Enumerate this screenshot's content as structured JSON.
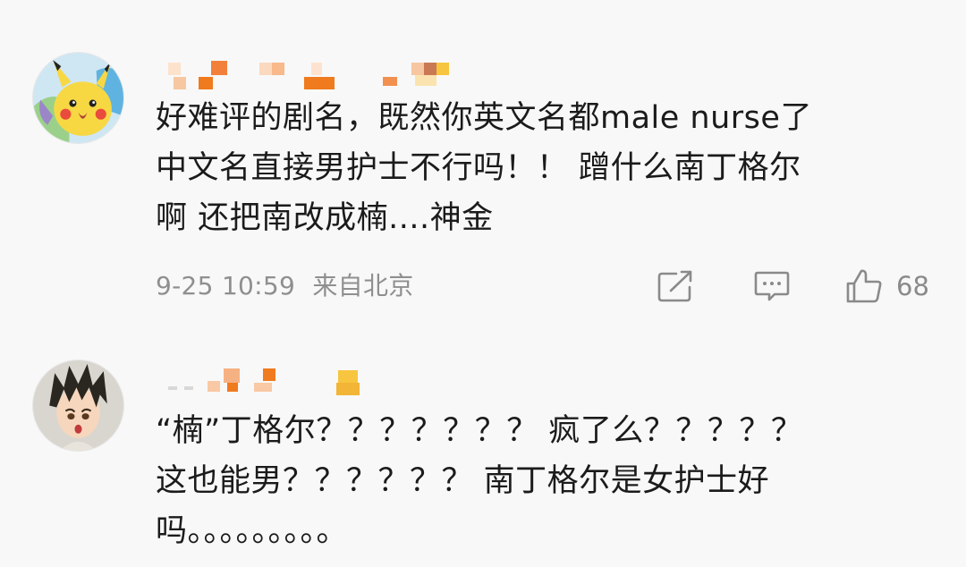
{
  "comments": [
    {
      "text": "好难评的剧名，既然你英文名都male nurse了\n中文名直接男护士不行吗！！ 蹭什么南丁格尔\n啊 还把南改成楠....神金",
      "timestamp": "9-25 10:59",
      "location": "来自北京",
      "avatar_icon": "pikachu-avatar-icon",
      "likes": "68"
    },
    {
      "text": "“楠”丁格尔？？？？？？？ 疯了么？？？？？\n这也能男？？？？？？ 南丁格尔是女护士好\n吗。。。。。。。。。",
      "avatar_icon": "anime-boy-avatar-icon"
    }
  ],
  "icons": {
    "share": "share-icon",
    "comment": "comment-icon",
    "like": "thumbs-up-icon"
  },
  "colors": {
    "background": "#f8f8f8",
    "text": "#1b1b1b",
    "meta": "#8f8f8f",
    "mosaic_orange": "#f07a1e",
    "mosaic_yellow": "#f7c53f"
  }
}
